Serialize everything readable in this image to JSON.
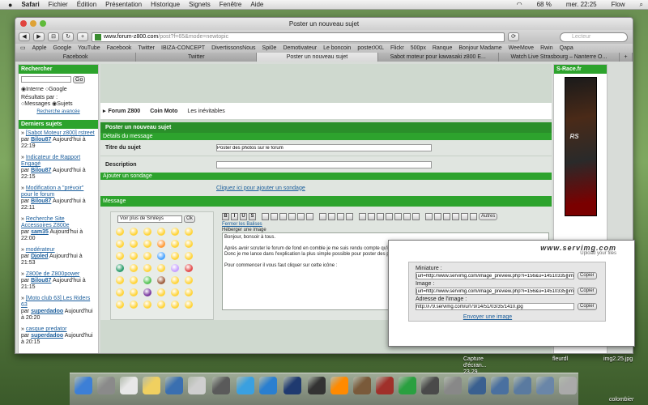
{
  "menubar": {
    "apple": "",
    "app": "Safari",
    "items": [
      "Fichier",
      "Édition",
      "Présentation",
      "Historique",
      "Signets",
      "Fenêtre",
      "Aide"
    ],
    "battery": "68 %",
    "clock": "mer. 22:25",
    "user": "Flow"
  },
  "window": {
    "title": "Poster un nouveau sujet",
    "url_domain": "www.forum-z800.com",
    "url_path": "/post?f=65&mode=newtopic",
    "search_placeholder": "Lecteur"
  },
  "bookmarks": [
    "Apple",
    "Google",
    "YouTube",
    "Facebook",
    "Twitter",
    "IBIZA-CONCEPT",
    "DivertissonsNous",
    "Spi0e",
    "Demotivateur",
    "Le boncoin",
    "posterXXL",
    "Flickr",
    "500px",
    "Ranque",
    "Bonjour Madame",
    "WeeMove",
    "Rwin",
    "Qapa"
  ],
  "tabs": [
    "Facebook",
    "Twitter",
    "Poster un nouveau sujet",
    "Sabot moteur pour kawasaki z800 E...",
    "Watch Live Strasbourg – Nanterre O...",
    "+"
  ],
  "sidebar": {
    "search_title": "Rechercher",
    "go": "Go",
    "opt_internal": "Interne",
    "opt_google": "Google",
    "results_label": "Résultats par :",
    "opt_messages": "Messages",
    "opt_sujets": "Sujets",
    "advanced": "Recherche avancée",
    "latest_title": "Derniers sujets",
    "topics": [
      {
        "title": "[Sabot Moteur z800] rstreet",
        "by": "par",
        "user": "Bilou87",
        "time": "Aujourd'hui à 22:19"
      },
      {
        "title": "Indicateur de Rapport Engagé",
        "by": "par",
        "user": "Bilou87",
        "time": "Aujourd'hui à 22:15"
      },
      {
        "title": "Modification a \"prévoir\" pour le forum",
        "by": "par",
        "user": "Bilou87",
        "time": "Aujourd'hui à 22:11"
      },
      {
        "title": "Recherche Site Accessoires Z800e",
        "by": "par",
        "user": "sam35",
        "time": "Aujourd'hui à 22:00"
      },
      {
        "title": "modérateur",
        "by": "par",
        "user": "Djoled",
        "time": "Aujourd'hui à 21:53"
      },
      {
        "title": "Z800e de Z800power",
        "by": "par",
        "user": "Bilou87",
        "time": "Aujourd'hui à 21:15"
      },
      {
        "title": "[Moto club 63] Les Riders 63",
        "by": "par",
        "user": "superdadoo",
        "time": "Aujourd'hui à 20:20"
      },
      {
        "title": "casque predator",
        "by": "par",
        "user": "superdadoo",
        "time": "Aujourd'hui à 20:15"
      }
    ]
  },
  "right": {
    "title": "S-Race.fr"
  },
  "breadcrumb": {
    "home": "Forum Z800",
    "section": "Coin Moto",
    "sub": "Les inévitables"
  },
  "form": {
    "heading": "Poster un nouveau sujet",
    "details": "Détails du message",
    "subject_label": "Titre du sujet",
    "subject_value": "Poster des photos sur le forum",
    "desc_label": "Description",
    "poll_bar": "Ajouter un sondage",
    "poll_link": "Cliquez ici pour ajouter un sondage",
    "message_bar": "Message"
  },
  "smileys": {
    "select": "Voir plus de Smileys",
    "ok": "Ok"
  },
  "editor": {
    "close_tags": "Fermer les Balises",
    "autres": "Autres",
    "host_image": "Héberger une image",
    "body": [
      "Bonjour, bonsoir à tous.",
      "",
      "Après avoir scruter le forum de fond en comble je me suis rendu compte qu'il n'y avait aucune explication pour poster des photos sur le forum.",
      "Donc je me lance dans l'explication la plus simple possible pour poster des photos.",
      "",
      "Pour commencer il vous faut cliquer sur cette icône :"
    ]
  },
  "popup": {
    "brand": "www.servimg.com",
    "tagline": "Upload your files",
    "miniature_label": "Miniature :",
    "miniature_value": "[url=http://www.servimg.com/image_preview.php?i=156&u=14510335][im",
    "image_label": "Image :",
    "image_value": "[url=http://www.servimg.com/image_preview.php?i=156&u=14510335][im",
    "address_label": "Adresse de l'image :",
    "address_value": "http://i79.servimg.com/u/f79/14/51/03/35/1410.jpg",
    "copy": "Copier",
    "send_link": "Envoyer une image"
  },
  "desktop": {
    "capture": "Capture d'écran... 23.29",
    "fleurdl": "fleurdl",
    "img2": "img2.25.jpg",
    "footer": "colombier"
  },
  "colors": {
    "green": "#2da32d",
    "accent": "#1b5e9c"
  }
}
